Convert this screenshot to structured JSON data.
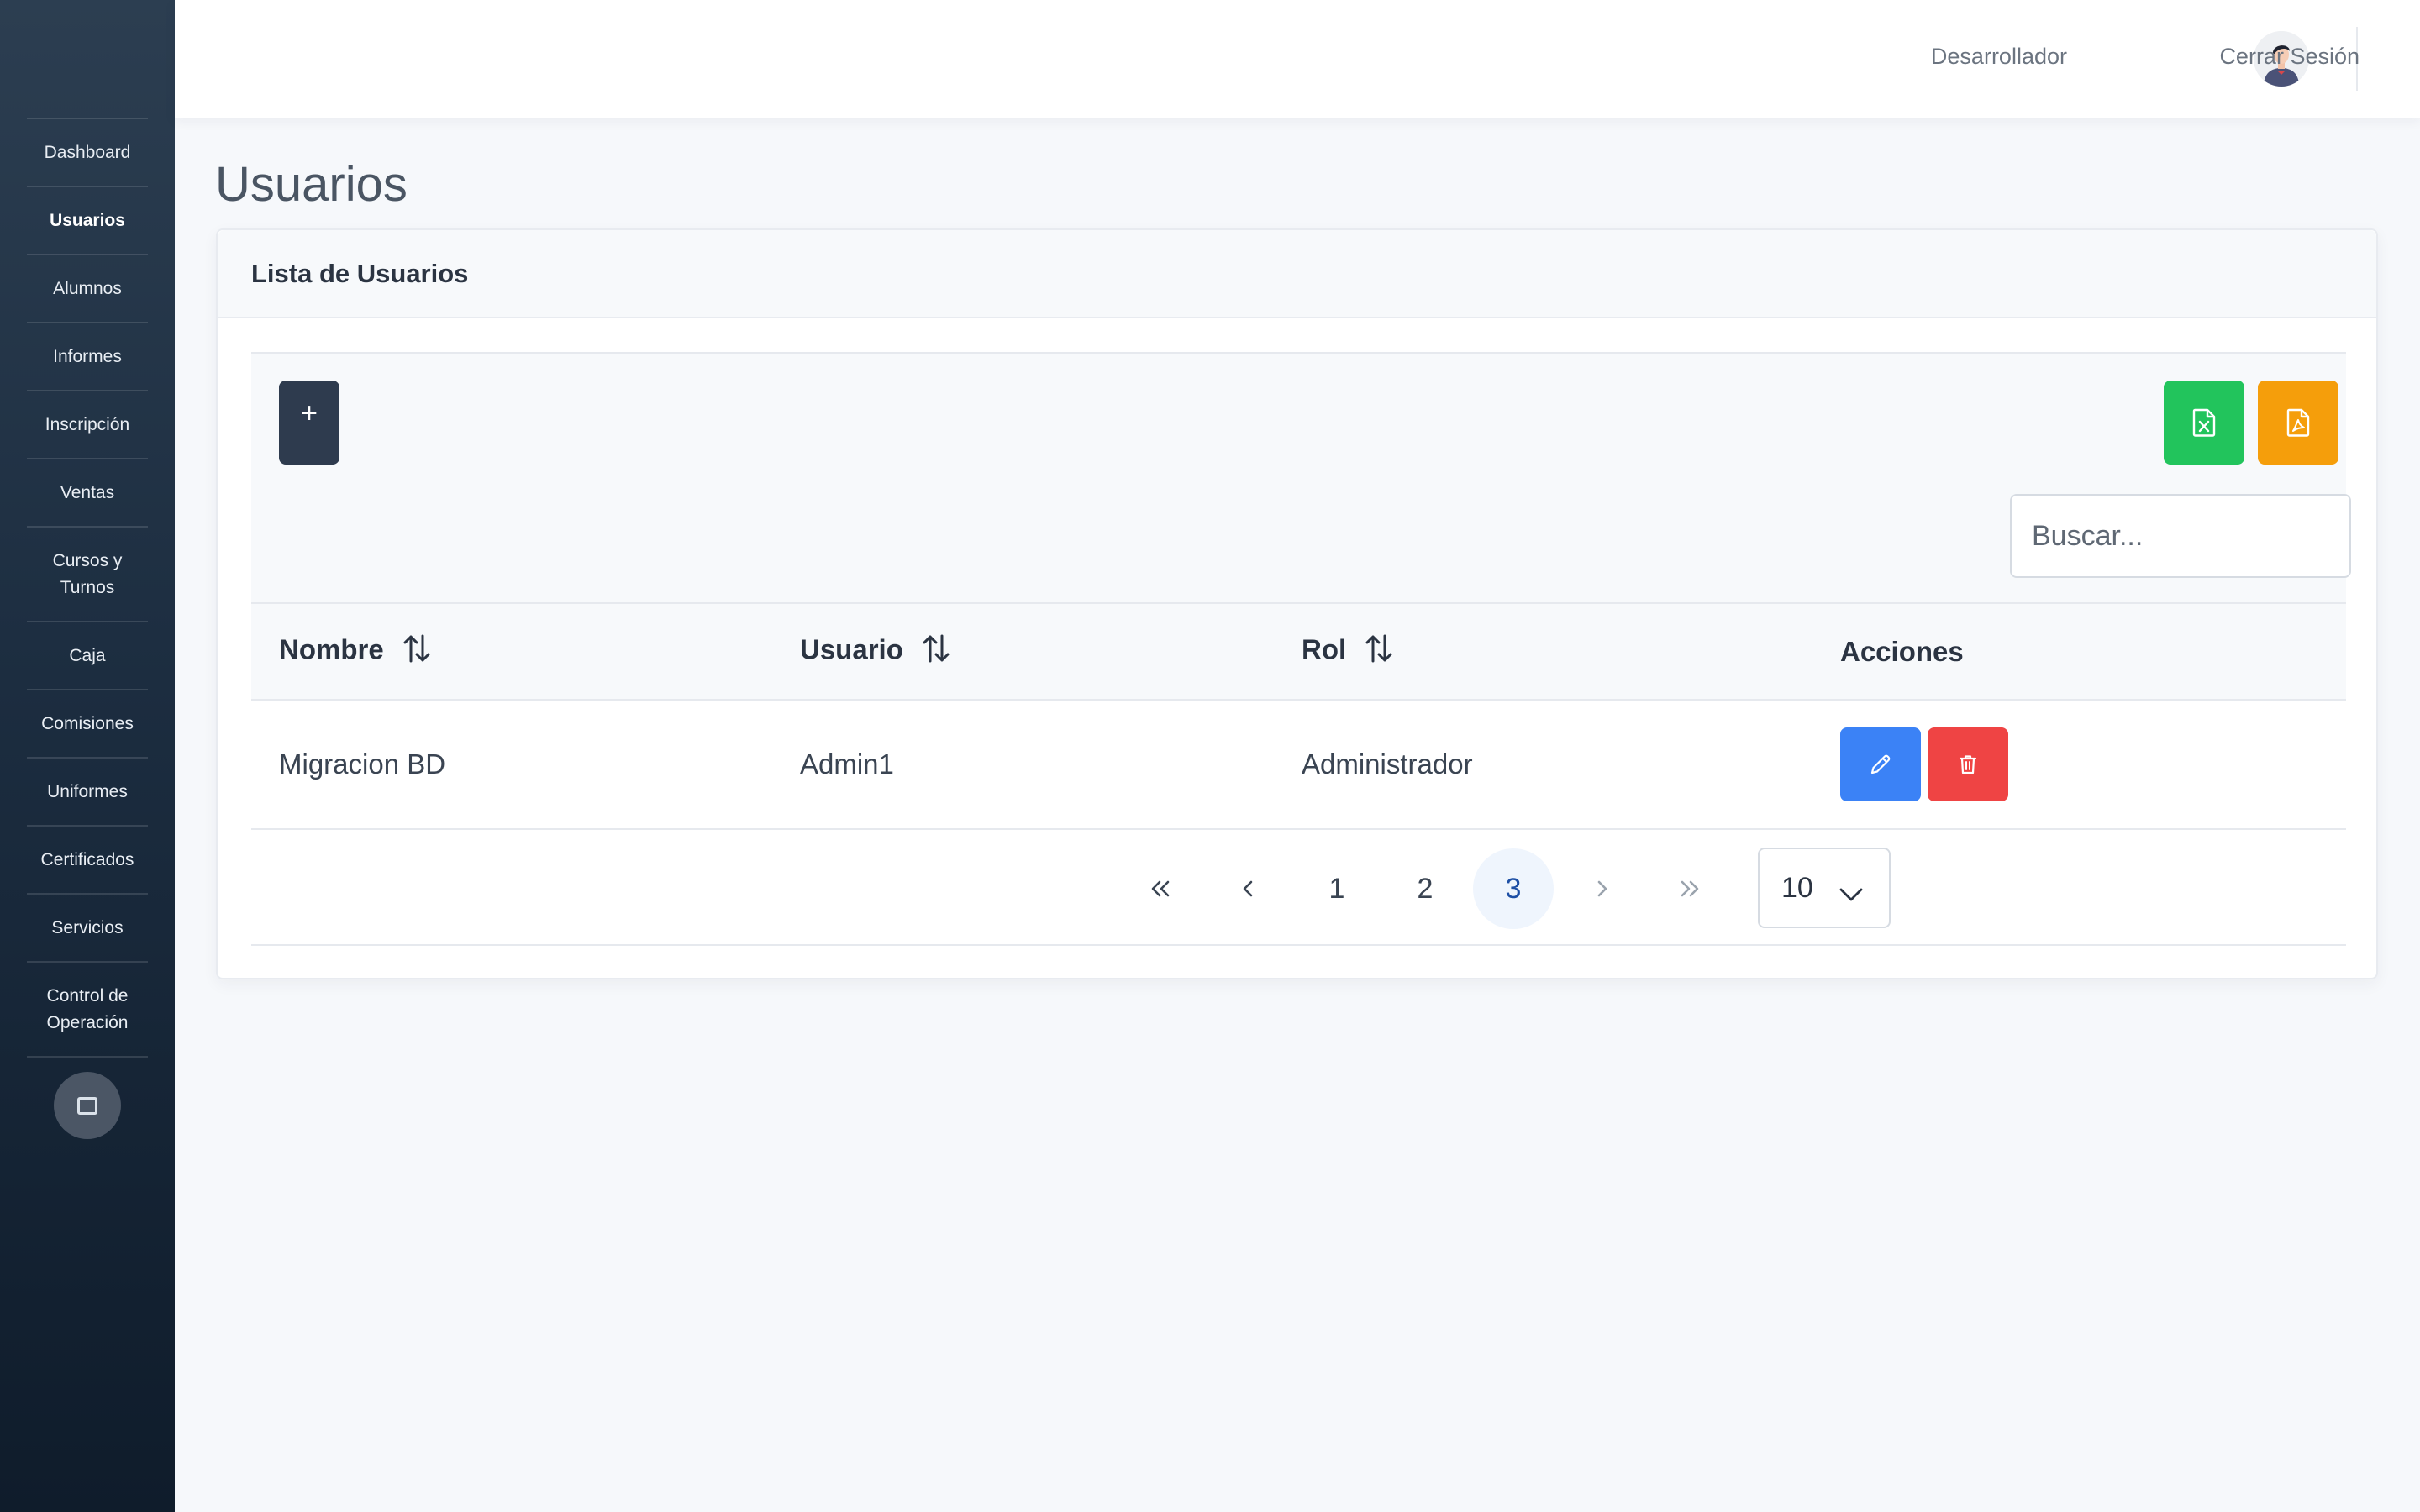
{
  "sidebar": {
    "items": [
      {
        "label": "Dashboard"
      },
      {
        "label": "Usuarios"
      },
      {
        "label": "Alumnos"
      },
      {
        "label": "Informes"
      },
      {
        "label": "Inscripción"
      },
      {
        "label": "Ventas"
      },
      {
        "label": "Cursos y Turnos"
      },
      {
        "label": "Caja"
      },
      {
        "label": "Comisiones"
      },
      {
        "label": "Uniformes"
      },
      {
        "label": "Certificados"
      },
      {
        "label": "Servicios"
      },
      {
        "label": "Control de Operación"
      }
    ],
    "active_item": "Usuarios",
    "toggle_icon": "square-icon"
  },
  "header": {
    "user_name": "Desarrollador",
    "avatar_icon": "user-avatar",
    "logout_label": "Cerrar Sesión"
  },
  "page": {
    "title": "Usuarios"
  },
  "card": {
    "title": "Lista de Usuarios",
    "add_label": "+",
    "export_excel_icon": "file-excel-icon",
    "export_pdf_icon": "file-pdf-icon",
    "search_placeholder": "Buscar...",
    "columns": [
      "Nombre",
      "Usuario",
      "Rol",
      "Acciones"
    ],
    "rows": [
      {
        "nombre": "Migracion BD",
        "usuario": "Admin1",
        "rol": "Administrador"
      }
    ],
    "pagination": {
      "pages": [
        "1",
        "2",
        "3"
      ],
      "current_page": "3",
      "page_size": "10"
    }
  },
  "colors": {
    "sidebar_top": "#2c3e51",
    "sidebar_bottom": "#0f1c2b",
    "add_button": "#2e3b4e",
    "excel_button": "#22c45c",
    "pdf_button": "#f59e0b",
    "edit_button": "#3b82f6",
    "delete_button": "#ef4444",
    "active_page_bg": "#eff5fd",
    "active_page_text": "#1d4fa5"
  }
}
